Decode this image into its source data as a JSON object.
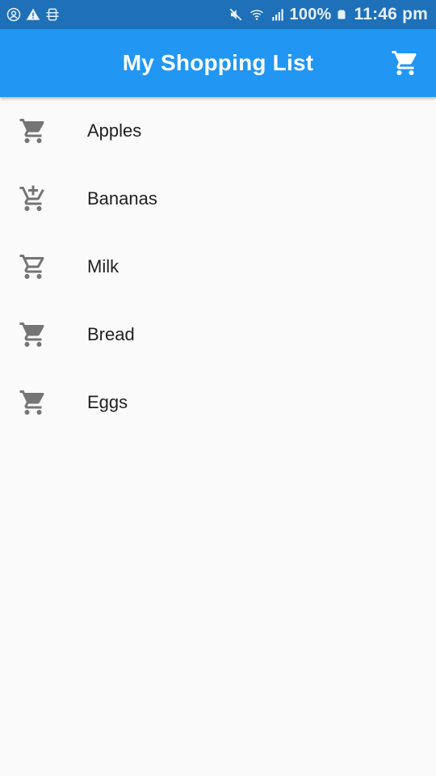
{
  "status_bar": {
    "battery": "100%",
    "time": "11:46 pm",
    "icons": [
      "account-circle-icon",
      "warning-icon",
      "vpn-icon",
      "mute-icon",
      "wifi-icon",
      "signal-icon",
      "battery-icon"
    ]
  },
  "app_bar": {
    "title": "My Shopping List",
    "action_icon": "shopping-cart-icon",
    "color": "#2196f3"
  },
  "items": [
    {
      "label": "Apples",
      "icon": "shopping-cart-icon"
    },
    {
      "label": "Bananas",
      "icon": "add-shopping-cart-icon"
    },
    {
      "label": "Milk",
      "icon": "shopping-cart-outline-icon"
    },
    {
      "label": "Bread",
      "icon": "shopping-cart-icon"
    },
    {
      "label": "Eggs",
      "icon": "shopping-cart-icon"
    }
  ],
  "colors": {
    "status_bar": "#1e70b8",
    "icon_grey": "#757575",
    "text": "#212121",
    "background": "#fafafa"
  }
}
